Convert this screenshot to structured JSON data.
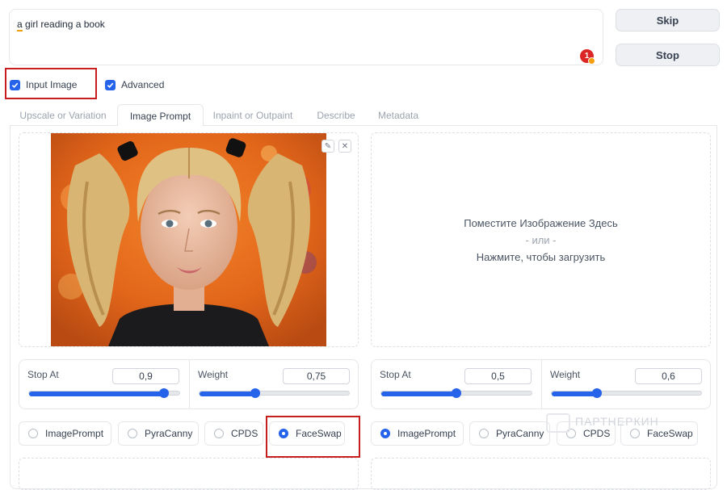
{
  "prompt": {
    "text_underlined": "a",
    "text_rest": " girl reading a book",
    "badge": "1"
  },
  "buttons": {
    "skip": "Skip",
    "stop": "Stop"
  },
  "options": {
    "input_image": "Input Image",
    "advanced": "Advanced"
  },
  "tabs": [
    {
      "label": "Upscale or Variation"
    },
    {
      "label": "Image Prompt"
    },
    {
      "label": "Inpaint or Outpaint"
    },
    {
      "label": "Describe"
    },
    {
      "label": "Metadata"
    }
  ],
  "dropzone": {
    "line1": "Поместите Изображение Здесь",
    "line2": "- или -",
    "line3": "Нажмите, чтобы загрузить"
  },
  "sliders_left": {
    "stop_label": "Stop At",
    "stop_value": "0,9",
    "stop_fraction": 0.9,
    "weight_label": "Weight",
    "weight_value": "0,75",
    "weight_fraction": 0.375
  },
  "sliders_right": {
    "stop_label": "Stop At",
    "stop_value": "0,5",
    "stop_fraction": 0.5,
    "weight_label": "Weight",
    "weight_value": "0,6",
    "weight_fraction": 0.3
  },
  "radios_left": [
    "ImagePrompt",
    "PyraCanny",
    "CPDS",
    "FaceSwap"
  ],
  "radios_left_selected": "FaceSwap",
  "radios_right": [
    "ImagePrompt",
    "PyraCanny",
    "CPDS",
    "FaceSwap"
  ],
  "radios_right_selected": "ImagePrompt",
  "watermark": "ПАРТНЕРКИН",
  "colors": {
    "accent": "#2563eb",
    "highlight": "#c81e1e"
  }
}
